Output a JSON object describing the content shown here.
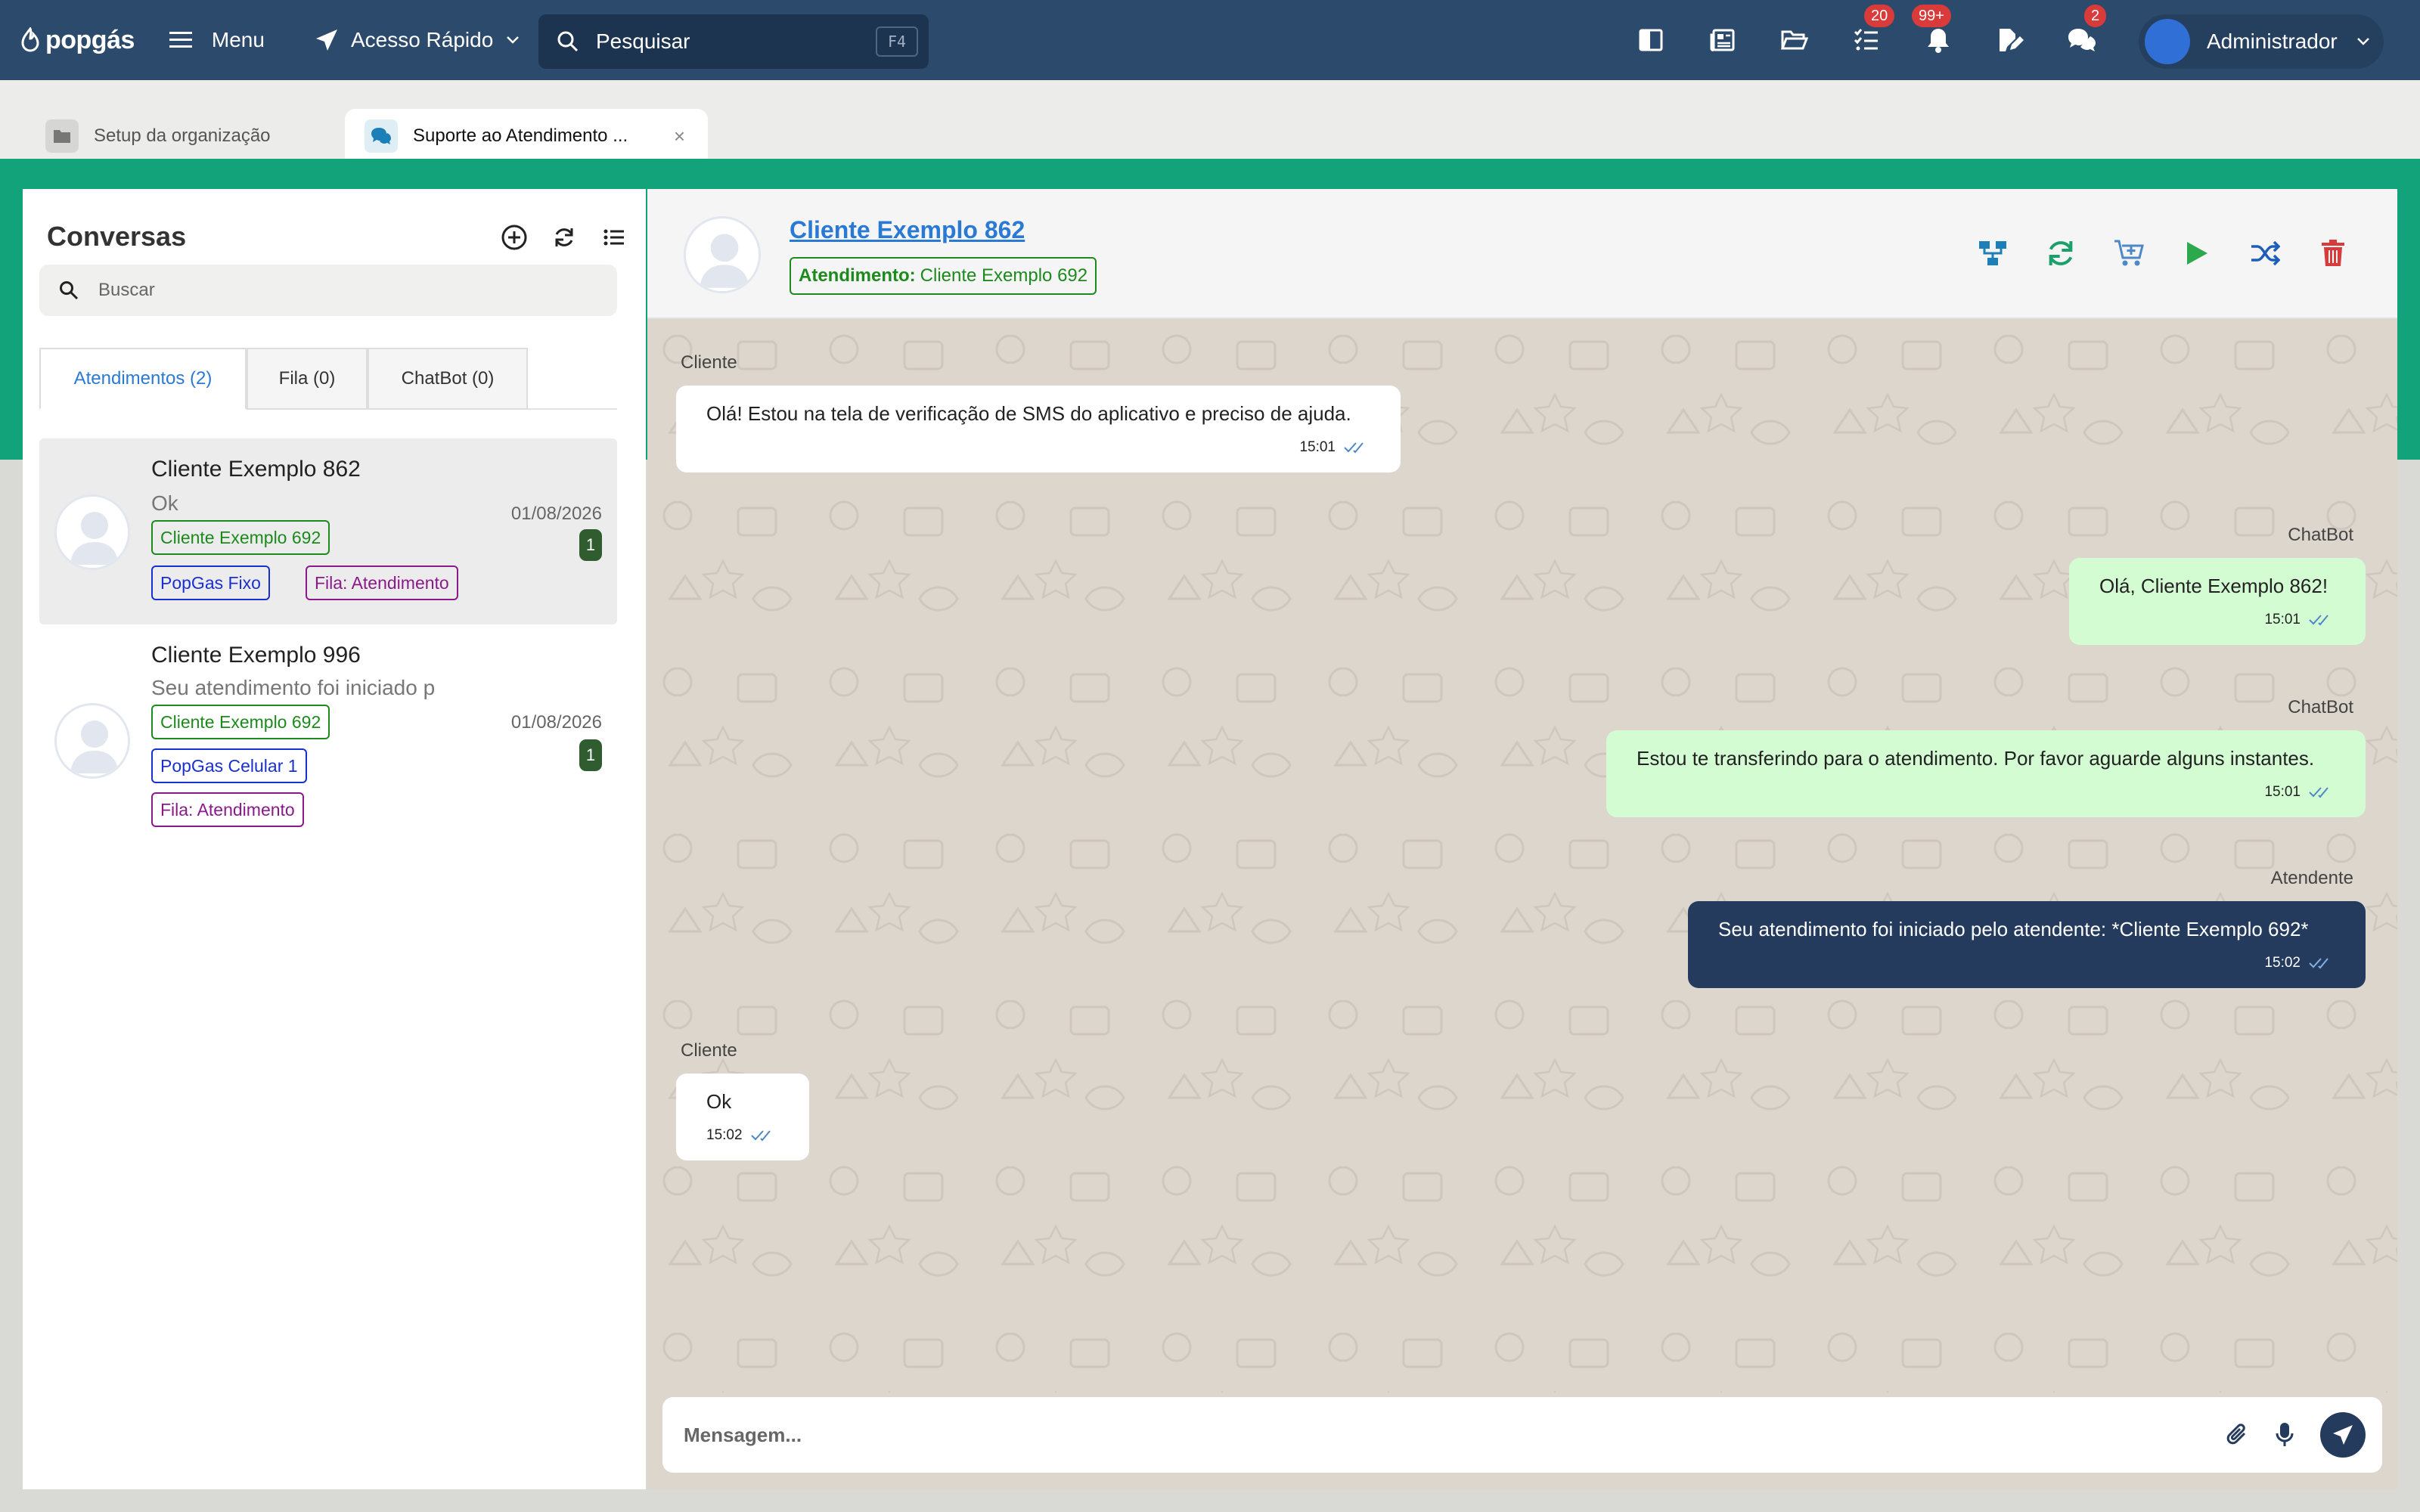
{
  "topbar": {
    "logo": "popgás",
    "menu_label": "Menu",
    "quick_access_label": "Acesso Rápido",
    "search_placeholder": "Pesquisar",
    "search_shortcut": "F4",
    "icons": [
      {
        "name": "book-icon"
      },
      {
        "name": "newspaper-icon"
      },
      {
        "name": "folder-open-icon"
      },
      {
        "name": "task-list-icon",
        "badge": "20"
      },
      {
        "name": "bell-icon",
        "badge": "99+"
      },
      {
        "name": "edit-document-icon"
      },
      {
        "name": "chat-icon",
        "badge": "2"
      }
    ],
    "user_name": "Administrador"
  },
  "tabs": [
    {
      "label": "Setup da organização",
      "icon": "folder-icon"
    },
    {
      "label": "Suporte ao Atendimento ...",
      "icon": "chat-bubbles-icon",
      "close": "×"
    }
  ],
  "conversations_panel": {
    "title": "Conversas",
    "search_placeholder": "Buscar",
    "tabs": [
      "Atendimentos (2)",
      "Fila (0)",
      "ChatBot (0)"
    ],
    "items": [
      {
        "name": "Cliente Exemplo 862",
        "preview": "Ok",
        "date": "01/08/2026",
        "unread": "1",
        "tags": [
          {
            "text": "Cliente Exemplo 692",
            "color": "green"
          },
          {
            "text": "PopGas Fixo",
            "color": "blue"
          },
          {
            "text": "Fila: Atendimento",
            "color": "purple"
          }
        ]
      },
      {
        "name": "Cliente Exemplo 996",
        "preview": "Seu atendimento foi iniciado p",
        "date": "01/08/2026",
        "unread": "1",
        "tags": [
          {
            "text": "Cliente Exemplo 692",
            "color": "green"
          },
          {
            "text": "PopGas Celular 1",
            "color": "blue"
          },
          {
            "text": "Fila: Atendimento",
            "color": "purple"
          }
        ]
      }
    ]
  },
  "chat": {
    "title": "Cliente Exemplo 862",
    "attendance_label": "Atendimento:",
    "attendance_value": "Cliente Exemplo 692",
    "messages": [
      {
        "sender": "Cliente",
        "text": "Olá! Estou na tela de verificação de SMS do aplicativo e preciso de ajuda.",
        "time": "15:01",
        "side": "in"
      },
      {
        "sender": "ChatBot",
        "text": "Olá, Cliente Exemplo 862!",
        "time": "15:01",
        "side": "out"
      },
      {
        "sender": "ChatBot",
        "text": "Estou te transferindo para o atendimento. Por favor aguarde alguns instantes.",
        "time": "15:01",
        "side": "out"
      },
      {
        "sender": "Atendente",
        "text": "Seu atendimento foi iniciado pelo atendente: *Cliente Exemplo 692*",
        "time": "15:02",
        "side": "agent"
      },
      {
        "sender": "Cliente",
        "text": "Ok",
        "time": "15:02",
        "side": "in"
      }
    ],
    "composer_placeholder": "Mensagem..."
  },
  "colors": {
    "topbar": "#2c4a6b",
    "green_band": "#12a37a",
    "chat_bg": "#ddd6cd",
    "agent_bubble": "#243b5e",
    "bot_bubble": "#d4fcd2"
  }
}
